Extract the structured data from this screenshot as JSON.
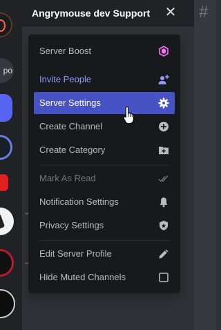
{
  "header": {
    "guild_name": "Angrymouse dev Support",
    "close_glyph": "✕",
    "channel_glyph": "#"
  },
  "rail": {
    "partial_label": "po"
  },
  "menu": {
    "items": [
      {
        "label": "Server Boost",
        "icon": "boost-icon",
        "state": "normal"
      },
      {
        "label": "Invite People",
        "icon": "add-person-icon",
        "state": "accent"
      },
      {
        "label": "Server Settings",
        "icon": "gear-icon",
        "state": "active"
      },
      {
        "label": "Create Channel",
        "icon": "plus-circle-icon",
        "state": "normal"
      },
      {
        "label": "Create Category",
        "icon": "folder-plus-icon",
        "state": "normal"
      },
      {
        "label": "Mark As Read",
        "icon": "double-check-icon",
        "state": "muted"
      },
      {
        "label": "Notification Settings",
        "icon": "bell-icon",
        "state": "normal"
      },
      {
        "label": "Privacy Settings",
        "icon": "shield-icon",
        "state": "normal"
      },
      {
        "label": "Edit Server Profile",
        "icon": "pencil-icon",
        "state": "normal"
      },
      {
        "label": "Hide Muted Channels",
        "icon": "checkbox-icon",
        "state": "unchecked"
      }
    ]
  },
  "colors": {
    "active_bg": "#4752c4",
    "accent_text": "#949cf7",
    "boost_pink": "#ff73fa",
    "menu_bg": "#18191c"
  }
}
